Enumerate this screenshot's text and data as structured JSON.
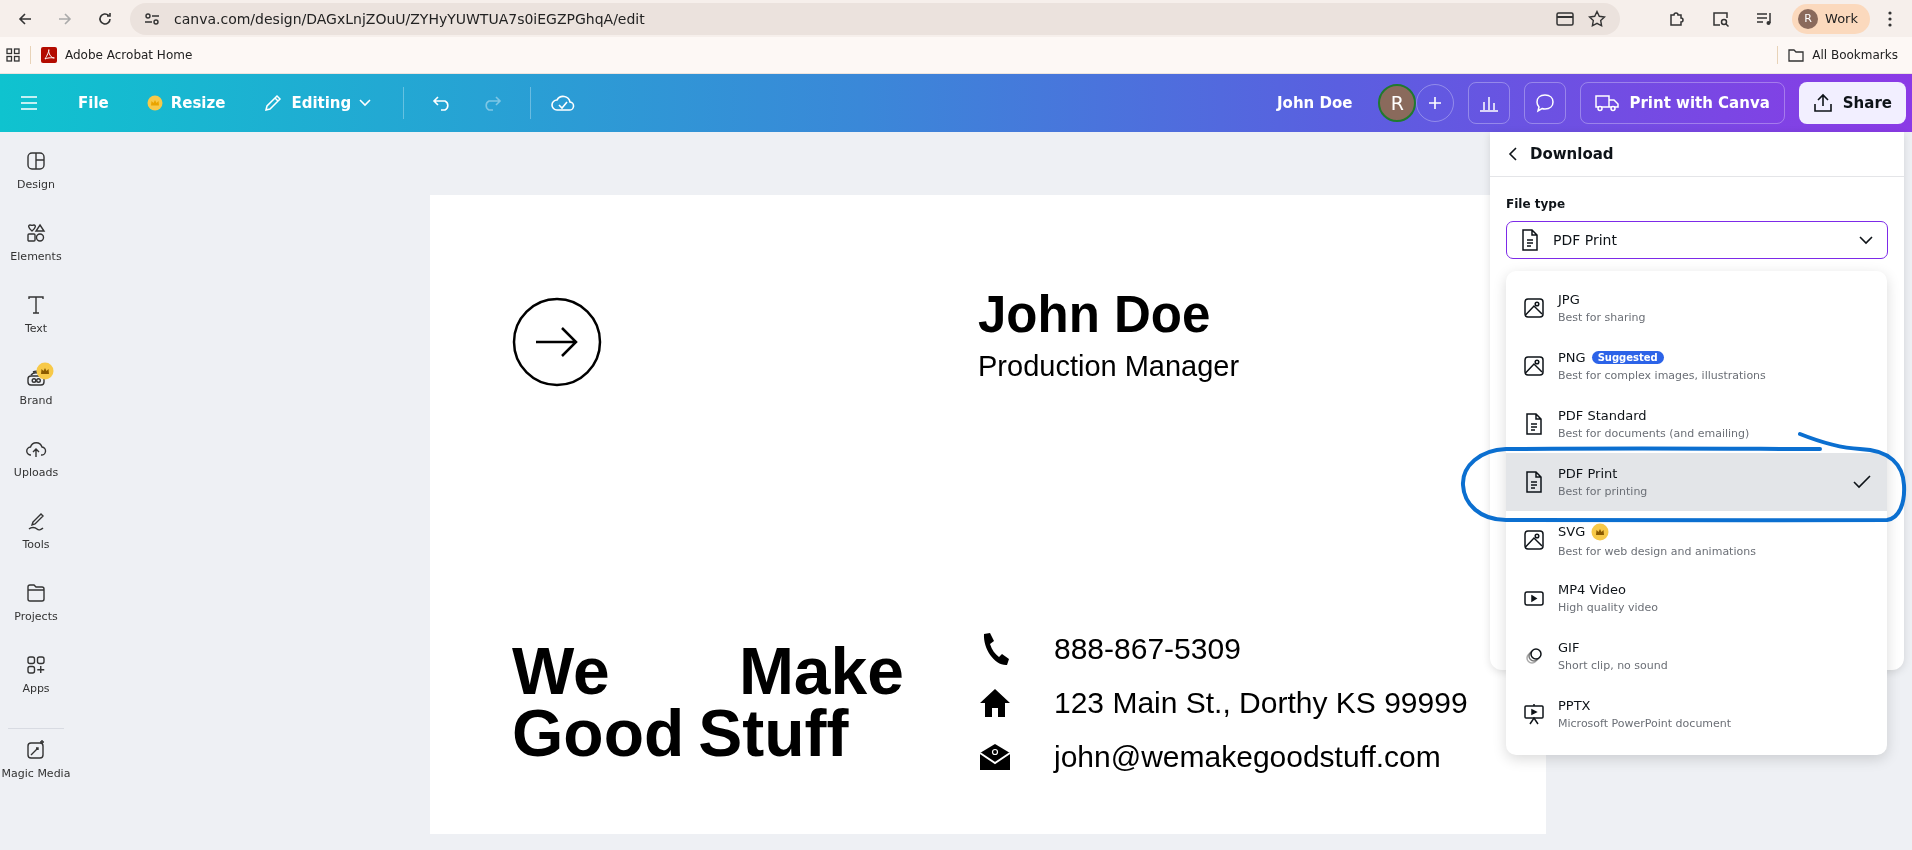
{
  "browser": {
    "url": "canva.com/design/DAGxLnjZOuU/ZYHyYUWTUA7s0iEGZPGhqA/edit",
    "nav": [
      {
        "kind": "back",
        "disabled": false
      },
      {
        "kind": "forward",
        "disabled": true
      },
      {
        "kind": "reload",
        "disabled": false
      }
    ],
    "profile": {
      "initial": "R",
      "label": "Work"
    },
    "bookmarks": [
      {
        "label": "Adobe Acrobat Home"
      }
    ],
    "all_bookmarks": "All Bookmarks"
  },
  "toolbar": {
    "menu": [
      {
        "kind": "file",
        "label": "File"
      },
      {
        "kind": "resize",
        "label": "Resize"
      },
      {
        "kind": "editing",
        "label": "Editing"
      }
    ],
    "history": [
      {
        "kind": "undo",
        "disabled": false
      },
      {
        "kind": "redo",
        "disabled": true
      }
    ],
    "doc_title": "John Doe",
    "avatar": "R",
    "print": "Print with Canva",
    "share": "Share"
  },
  "sidebar": {
    "items": [
      {
        "kind": "design",
        "label": "Design",
        "premium": false
      },
      {
        "kind": "elements",
        "label": "Elements",
        "premium": false
      },
      {
        "kind": "text",
        "label": "Text",
        "premium": false
      },
      {
        "kind": "brand",
        "label": "Brand",
        "premium": true
      },
      {
        "kind": "uploads",
        "label": "Uploads",
        "premium": false
      },
      {
        "kind": "tools",
        "label": "Tools",
        "premium": false
      },
      {
        "kind": "projects",
        "label": "Projects",
        "premium": false
      },
      {
        "kind": "apps",
        "label": "Apps",
        "premium": false
      },
      {
        "kind": "magic",
        "label": "Magic Media",
        "premium": false
      }
    ]
  },
  "card": {
    "name": "John Doe",
    "title": "Production Manager",
    "tagline": [
      [
        "We",
        "Make"
      ],
      [
        "Good",
        "Stuff"
      ]
    ],
    "contacts": [
      {
        "kind": "phone",
        "text": "888-867-5309"
      },
      {
        "kind": "home",
        "text": "123 Main St., Dorthy KS 99999"
      },
      {
        "kind": "email",
        "text": "john@wemakegoodstuff.com"
      }
    ]
  },
  "download": {
    "title": "Download",
    "file_type_label": "File type",
    "value": "PDF Print",
    "options": [
      {
        "kind": "image",
        "name": "JPG",
        "desc": "Best for sharing",
        "premium": false,
        "selected": false
      },
      {
        "kind": "image",
        "name": "PNG",
        "desc": "Best for complex images, illustrations",
        "badge": "Suggested",
        "premium": false,
        "selected": false
      },
      {
        "kind": "document",
        "name": "PDF Standard",
        "desc": "Best for documents (and emailing)",
        "premium": false,
        "selected": false
      },
      {
        "kind": "document",
        "name": "PDF Print",
        "desc": "Best for printing",
        "premium": false,
        "selected": true
      },
      {
        "kind": "image",
        "name": "SVG",
        "desc": "Best for web design and animations",
        "premium": true,
        "selected": false
      },
      {
        "kind": "video",
        "name": "MP4 Video",
        "desc": "High quality video",
        "premium": false,
        "selected": false
      },
      {
        "kind": "gif",
        "name": "GIF",
        "desc": "Short clip, no sound",
        "premium": false,
        "selected": false
      },
      {
        "kind": "slides",
        "name": "PPTX",
        "desc": "Microsoft PowerPoint document",
        "premium": false,
        "selected": false
      }
    ]
  }
}
